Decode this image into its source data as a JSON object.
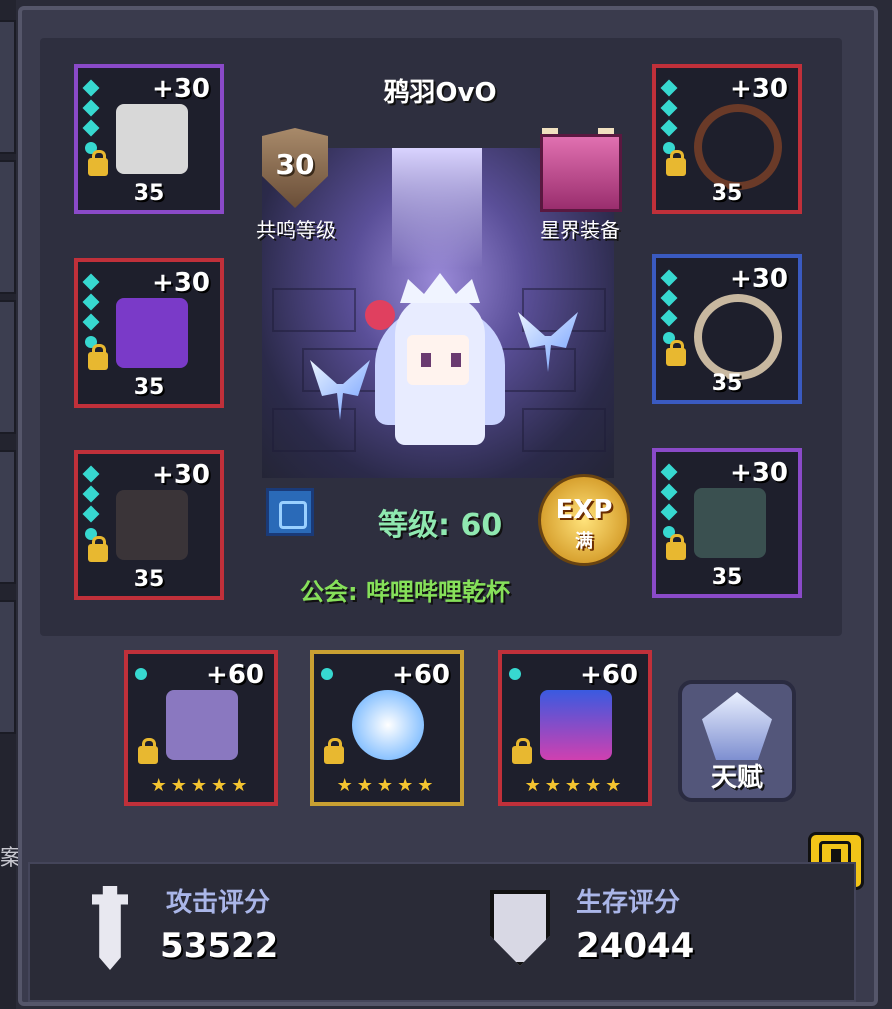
{
  "player": {
    "name": "鸦羽OvO",
    "level_label": "等级: 60",
    "guild_label": "公会: 哔哩哔哩乾杯"
  },
  "resonance": {
    "level": "30",
    "label": "共鸣等级"
  },
  "astral": {
    "label": "星界装备"
  },
  "exp_badge": {
    "top": "EXP",
    "bottom": "满"
  },
  "left_slots": [
    {
      "bonus": "+30",
      "level": "35",
      "rarity": "purple",
      "item": "mask-helmet"
    },
    {
      "bonus": "+30",
      "level": "35",
      "rarity": "red",
      "item": "purple-octopus"
    },
    {
      "bonus": "+30",
      "level": "35",
      "rarity": "red",
      "item": "dark-armor"
    }
  ],
  "right_slots": [
    {
      "bonus": "+30",
      "level": "35",
      "rarity": "red",
      "item": "fire-necklace"
    },
    {
      "bonus": "+30",
      "level": "35",
      "rarity": "blue",
      "item": "bone-ring"
    },
    {
      "bonus": "+30",
      "level": "35",
      "rarity": "purple",
      "item": "cat-pet"
    }
  ],
  "bottom_slots": [
    {
      "bonus": "+60",
      "rarity": "red",
      "stars": "★★★★★",
      "item": "purple-gauntlet"
    },
    {
      "bonus": "+60",
      "rarity": "gold",
      "stars": "★★★★★",
      "item": "eye-orb"
    },
    {
      "bonus": "+60",
      "rarity": "red",
      "stars": "★★★★★",
      "item": "blue-claw"
    }
  ],
  "talent": {
    "label": "天赋"
  },
  "side_text": "案",
  "footer": {
    "attack_label": "攻击评分",
    "attack_value": "53522",
    "survival_label": "生存评分",
    "survival_value": "24044"
  },
  "colors": {
    "red": "#c0303a",
    "purple": "#8a4ac8",
    "blue": "#3a5ac0",
    "gold": "#c9a032",
    "level_text": "#8fe8b0",
    "guild_text": "#86e05a"
  }
}
